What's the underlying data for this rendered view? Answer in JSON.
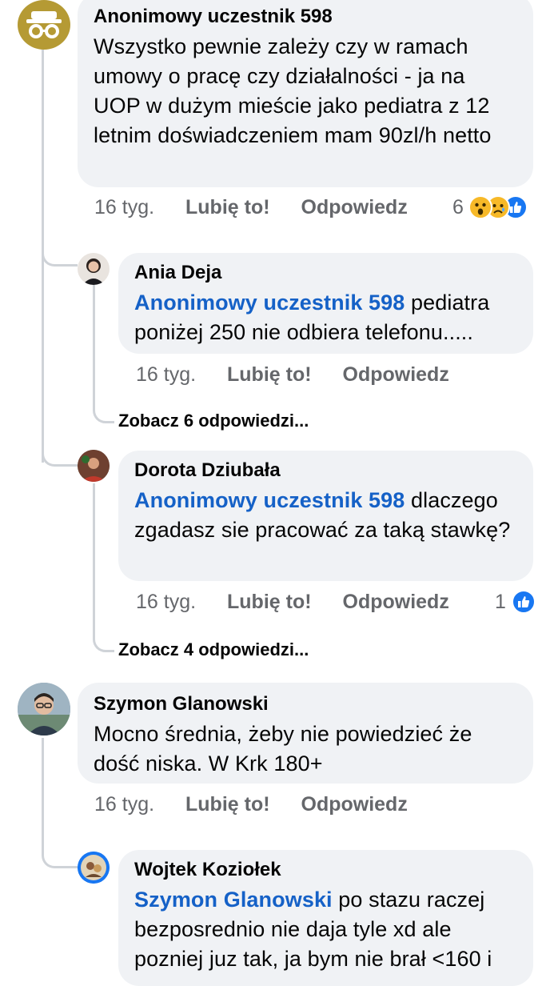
{
  "comments": [
    {
      "author": "Anonimowy uczestnik 598",
      "text": "Wszystko pewnie zależy czy w ramach umowy o pracę czy działalności - ja na UOP w dużym mieście jako pediatra z 12 letnim doświadczeniem mam 90zl/h netto",
      "time": "16 tyg.",
      "like": "Lubię to!",
      "reply": "Odpowiedz",
      "reaction_count": "6",
      "reactions": [
        "wow-icon",
        "sad-icon",
        "like-icon"
      ]
    },
    {
      "author": "Ania Deja",
      "mention": "Anonimowy uczestnik 598",
      "text": " pediatra poniżej 250 nie odbiera telefonu.....",
      "time": "16 tyg.",
      "like": "Lubię to!",
      "reply": "Odpowiedz",
      "more_replies": "Zobacz 6 odpowiedzi..."
    },
    {
      "author": "Dorota Dziubała",
      "mention": "Anonimowy uczestnik 598",
      "text": " dlaczego zgadasz sie pracować za taką stawkę?",
      "time": "16 tyg.",
      "like": "Lubię to!",
      "reply": "Odpowiedz",
      "reaction_count": "1",
      "reactions": [
        "like-icon"
      ],
      "more_replies": "Zobacz 4 odpowiedzi..."
    },
    {
      "author": "Szymon Glanowski",
      "text": "Mocno średnia, żeby nie powiedzieć że dość niska. W Krk 180+",
      "time": "16 tyg.",
      "like": "Lubię to!",
      "reply": "Odpowiedz"
    },
    {
      "author": "Wojtek Koziołek",
      "mention": "Szymon Glanowski",
      "text": " po stazu raczej bezposrednio nie daja tyle xd ale pozniej juz tak, ja bym nie brał <160 i"
    }
  ],
  "colors": {
    "bubble": "#f0f2f5",
    "mention": "#1561c7",
    "meta": "#65676b",
    "like_blue": "#1877f2",
    "anon_avatar": "#b59a34"
  }
}
